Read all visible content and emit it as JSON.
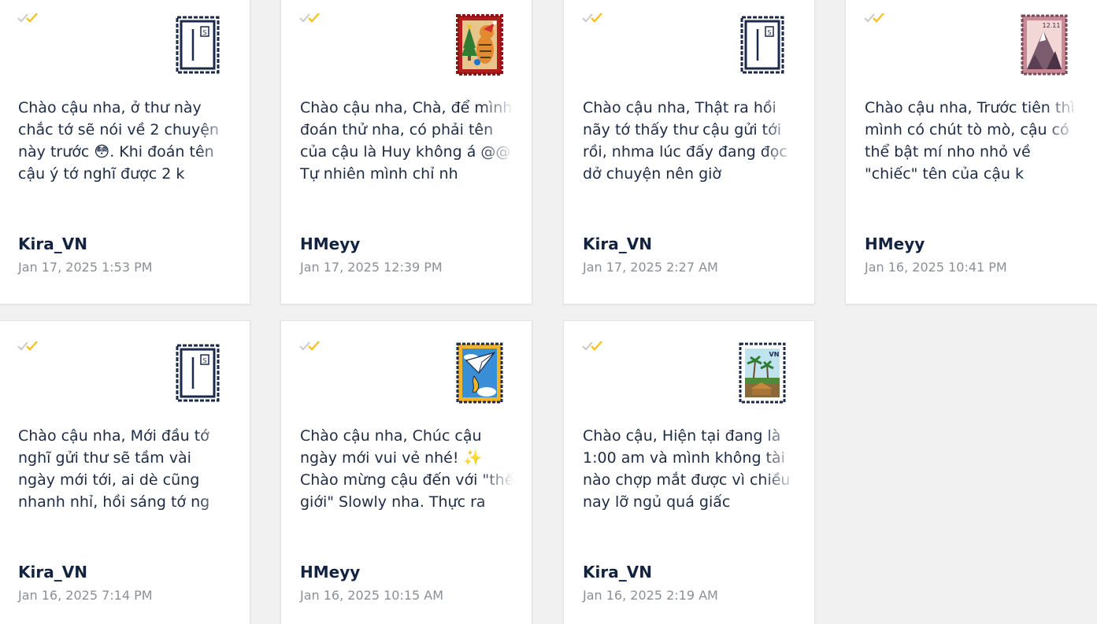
{
  "colors": {
    "background": "#f1f1f1",
    "card": "#ffffff",
    "text": "#1d2b45",
    "sender": "#13233f",
    "date": "#8a8f98",
    "check_gray": "#c9c9c9",
    "check_gold": "#f2c227",
    "stamp_navy": "#1b2a4a"
  },
  "letters": [
    {
      "preview": "Chào cậu nha, ở thư này chắc tớ sẽ nói về 2 chuyện này trước 😳. Khi đoán tên cậu ý tớ nghĩ được 2 k",
      "sender": "Kira_VN",
      "date": "Jan 17, 2025 1:53 PM",
      "stamp": "default-stamp-icon"
    },
    {
      "preview": "Chào cậu nha, Chà, để mình đoán thử nha, có phải tên của cậu là Huy không á @@ Tự nhiên mình chỉ nh",
      "sender": "HMeyy",
      "date": "Jan 17, 2025 12:39 PM",
      "stamp": "christmas-tiger-stamp-icon"
    },
    {
      "preview": "Chào cậu nha, Thật ra hồi nãy tớ thấy thư cậu gửi tới rồi, nhma lúc đấy đang đọc dở chuyện nên giờ",
      "sender": "Kira_VN",
      "date": "Jan 17, 2025 2:27 AM",
      "stamp": "default-stamp-icon"
    },
    {
      "preview": "Chào cậu nha, Trước tiên thì mình có chút tò mò, cậu có thể bật mí nho nhỏ về \"chiếc\" tên của cậu k",
      "sender": "HMeyy",
      "date": "Jan 16, 2025 10:41 PM",
      "stamp": "mountain-stamp-icon",
      "stamp_text": "12.11"
    },
    {
      "preview": "Chào cậu nha, Mới đầu tớ nghĩ gửi thư sẽ tầm vài ngày mới tới, ai dè cũng nhanh nhỉ, hồi sáng tớ ng",
      "sender": "Kira_VN",
      "date": "Jan 16, 2025 7:14 PM",
      "stamp": "default-stamp-icon"
    },
    {
      "preview": "Chào cậu nha, Chúc cậu ngày mới vui vẻ nhé! ✨ Chào mừng cậu đến với \"thế giới\" Slowly nha. Thực ra",
      "sender": "HMeyy",
      "date": "Jan 16, 2025 10:15 AM",
      "stamp": "paper-plane-stamp-icon"
    },
    {
      "preview": "Chào cậu, Hiện tại đang là 1:00 am và mình không tài nào chợp mắt được vì chiều nay lỡ ngủ quá giấc",
      "sender": "Kira_VN",
      "date": "Jan 16, 2025 2:19 AM",
      "stamp": "vietnam-village-stamp-icon",
      "stamp_text": "VN"
    }
  ]
}
